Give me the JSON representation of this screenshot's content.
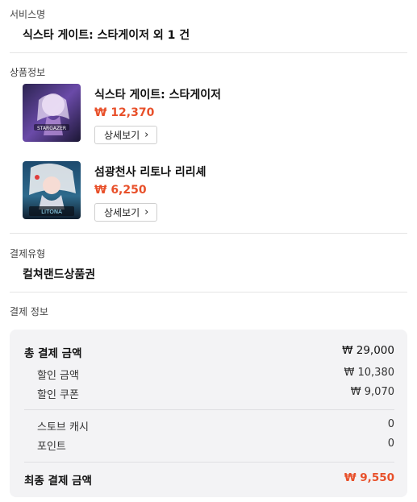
{
  "service": {
    "label": "서비스명",
    "value": "식스타 게이트: 스타게이저 외 1 건"
  },
  "products": {
    "label": "상품정보",
    "items": [
      {
        "title": "식스타 게이트: 스타게이저",
        "price": "₩ 12,370",
        "detail_label": "상세보기",
        "chevron": "›",
        "thumb_icon": "stargazer-game-cover"
      },
      {
        "title": "섬광천사 리토나 리리셰",
        "price": "₩ 6,250",
        "detail_label": "상세보기",
        "chevron": "›",
        "thumb_icon": "litona-game-cover"
      }
    ]
  },
  "payment_type": {
    "label": "결제유형",
    "value": "컬쳐랜드상품권"
  },
  "payment_info": {
    "label": "결제 정보",
    "total": {
      "label": "총 결제 금액",
      "value": "₩ 29,000"
    },
    "discount": {
      "label": "할인 금액",
      "value": "₩ 10,380"
    },
    "coupon": {
      "label": "할인 쿠폰",
      "value": "₩ 9,070"
    },
    "stove_cash": {
      "label": "스토브 캐시",
      "value": "0"
    },
    "points": {
      "label": "포인트",
      "value": "0"
    },
    "final": {
      "label": "최종 결제 금액",
      "value": "₩ 9,550"
    }
  },
  "colors": {
    "accent": "#e8502a",
    "box_bg": "#f3f3f5"
  }
}
